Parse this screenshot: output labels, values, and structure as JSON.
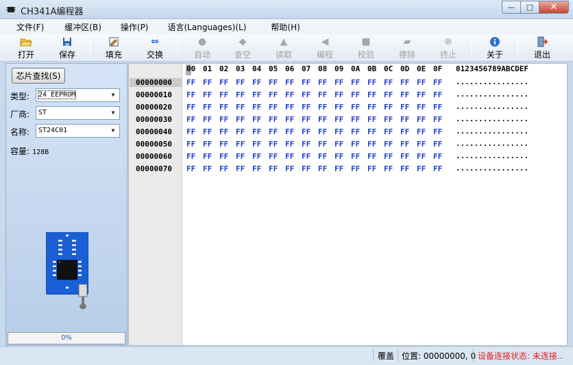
{
  "window": {
    "title": "CH341A编程器",
    "minimize": "—",
    "maximize": "□",
    "close": "✕"
  },
  "menu": [
    "文件(F)",
    "缓冲区(B)",
    "操作(P)",
    "语言(Languages)(L)",
    "帮助(H)"
  ],
  "toolbar": [
    {
      "label": "打开",
      "icon": "open-folder-icon",
      "enabled": true
    },
    {
      "label": "保存",
      "icon": "save-disk-icon",
      "enabled": true
    },
    {
      "label": "填充",
      "icon": "fill-icon",
      "enabled": true
    },
    {
      "label": "交换",
      "icon": "swap-arrows-icon",
      "enabled": true
    },
    {
      "label": "自动",
      "icon": "auto-icon",
      "enabled": false
    },
    {
      "label": "查空",
      "icon": "blank-check-icon",
      "enabled": false
    },
    {
      "label": "读取",
      "icon": "read-icon",
      "enabled": false
    },
    {
      "label": "编程",
      "icon": "program-icon",
      "enabled": false
    },
    {
      "label": "校验",
      "icon": "verify-icon",
      "enabled": false
    },
    {
      "label": "擦除",
      "icon": "erase-icon",
      "enabled": false
    },
    {
      "label": "终止",
      "icon": "stop-icon",
      "enabled": false
    },
    {
      "label": "关于",
      "icon": "info-icon",
      "enabled": true
    },
    {
      "label": "退出",
      "icon": "exit-icon",
      "enabled": true
    }
  ],
  "left": {
    "chip_find": "芯片查找(S)",
    "type_label": "类型:",
    "type_value": "24 EEPROM",
    "vendor_label": "厂商:",
    "vendor_value": "ST",
    "name_label": "名称:",
    "name_value": "ST24C01",
    "capacity_label": "容量:",
    "capacity_value": "128B",
    "progress": "0%"
  },
  "hex": {
    "columns": [
      "00",
      "01",
      "02",
      "03",
      "04",
      "05",
      "06",
      "07",
      "08",
      "09",
      "0A",
      "0B",
      "0C",
      "0D",
      "0E",
      "0F"
    ],
    "ascii_header": "0123456789ABCDEF",
    "rows": [
      {
        "addr": "00000000",
        "bytes": [
          "FF",
          "FF",
          "FF",
          "FF",
          "FF",
          "FF",
          "FF",
          "FF",
          "FF",
          "FF",
          "FF",
          "FF",
          "FF",
          "FF",
          "FF",
          "FF"
        ],
        "ascii": "................"
      },
      {
        "addr": "00000010",
        "bytes": [
          "FF",
          "FF",
          "FF",
          "FF",
          "FF",
          "FF",
          "FF",
          "FF",
          "FF",
          "FF",
          "FF",
          "FF",
          "FF",
          "FF",
          "FF",
          "FF"
        ],
        "ascii": "................"
      },
      {
        "addr": "00000020",
        "bytes": [
          "FF",
          "FF",
          "FF",
          "FF",
          "FF",
          "FF",
          "FF",
          "FF",
          "FF",
          "FF",
          "FF",
          "FF",
          "FF",
          "FF",
          "FF",
          "FF"
        ],
        "ascii": "................"
      },
      {
        "addr": "00000030",
        "bytes": [
          "FF",
          "FF",
          "FF",
          "FF",
          "FF",
          "FF",
          "FF",
          "FF",
          "FF",
          "FF",
          "FF",
          "FF",
          "FF",
          "FF",
          "FF",
          "FF"
        ],
        "ascii": "................"
      },
      {
        "addr": "00000040",
        "bytes": [
          "FF",
          "FF",
          "FF",
          "FF",
          "FF",
          "FF",
          "FF",
          "FF",
          "FF",
          "FF",
          "FF",
          "FF",
          "FF",
          "FF",
          "FF",
          "FF"
        ],
        "ascii": "................"
      },
      {
        "addr": "00000050",
        "bytes": [
          "FF",
          "FF",
          "FF",
          "FF",
          "FF",
          "FF",
          "FF",
          "FF",
          "FF",
          "FF",
          "FF",
          "FF",
          "FF",
          "FF",
          "FF",
          "FF"
        ],
        "ascii": "................"
      },
      {
        "addr": "00000060",
        "bytes": [
          "FF",
          "FF",
          "FF",
          "FF",
          "FF",
          "FF",
          "FF",
          "FF",
          "FF",
          "FF",
          "FF",
          "FF",
          "FF",
          "FF",
          "FF",
          "FF"
        ],
        "ascii": "................"
      },
      {
        "addr": "00000070",
        "bytes": [
          "FF",
          "FF",
          "FF",
          "FF",
          "FF",
          "FF",
          "FF",
          "FF",
          "FF",
          "FF",
          "FF",
          "FF",
          "FF",
          "FF",
          "FF",
          "FF"
        ],
        "ascii": "................"
      }
    ]
  },
  "status": {
    "mode": "覆盖",
    "position": "位置: 00000000, 0",
    "connection": "设备连接状态: 未连接.."
  },
  "colors": {
    "byte_blue": "#1e3fd0",
    "connection_red": "#e02020"
  }
}
